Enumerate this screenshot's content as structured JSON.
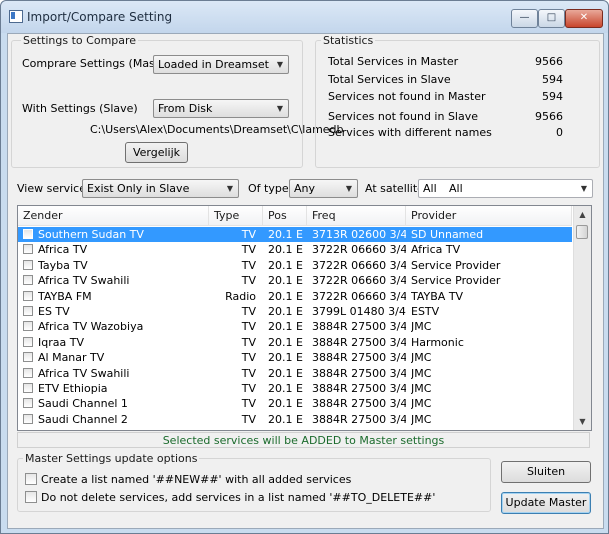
{
  "window": {
    "title": "Import/Compare Setting",
    "minimize_glyph": "—",
    "maximize_glyph": "□",
    "close_glyph": "✕"
  },
  "settings_group": {
    "title": "Settings to Compare",
    "master_label": "Comprare Settings (Master)",
    "master_value": "Loaded in Dreamset",
    "slave_label": "With Settings (Slave)",
    "slave_value": "From Disk",
    "path": "C:\\Users\\Alex\\Documents\\Dreamset\\C\\lamedb",
    "compare_button": "Vergelijk"
  },
  "statistics": {
    "title": "Statistics",
    "rows": [
      {
        "label": "Total Services in Master",
        "value": "9566"
      },
      {
        "label": "Total Services in Slave",
        "value": "594"
      },
      {
        "label": "Services not found in Master",
        "value": "594"
      },
      {
        "label": "Services not found in Slave",
        "value": "9566"
      },
      {
        "label": "Services with different names",
        "value": "0"
      }
    ]
  },
  "filters": {
    "view_label": "View services",
    "view_value": "Exist Only in Slave",
    "type_label": "Of type",
    "type_value": "Any",
    "satellite_label": "At satellite",
    "satellite_value_a": "All",
    "satellite_value_b": "All"
  },
  "table": {
    "columns": [
      "Zender",
      "Type",
      "Pos",
      "Freq",
      "Provider"
    ],
    "rows": [
      {
        "name": "Southern Sudan TV",
        "type": "TV",
        "pos": "20.1 E",
        "freq": "3713R 02600 3/4",
        "provider": "SD Unnamed",
        "selected": true
      },
      {
        "name": "Africa TV",
        "type": "TV",
        "pos": "20.1 E",
        "freq": "3722R 06660 3/4",
        "provider": "Africa TV"
      },
      {
        "name": "Tayba TV",
        "type": "TV",
        "pos": "20.1 E",
        "freq": "3722R 06660 3/4",
        "provider": "Service Provider"
      },
      {
        "name": "Africa TV Swahili",
        "type": "TV",
        "pos": "20.1 E",
        "freq": "3722R 06660 3/4",
        "provider": "Service Provider"
      },
      {
        "name": "TAYBA FM",
        "type": "Radio",
        "pos": "20.1 E",
        "freq": "3722R 06660 3/4",
        "provider": "TAYBA TV"
      },
      {
        "name": "ES TV",
        "type": "TV",
        "pos": "20.1 E",
        "freq": "3799L 01480 3/4",
        "provider": "ESTV"
      },
      {
        "name": "Africa TV Wazobiya",
        "type": "TV",
        "pos": "20.1 E",
        "freq": "3884R 27500 3/4",
        "provider": "JMC"
      },
      {
        "name": "Iqraa TV",
        "type": "TV",
        "pos": "20.1 E",
        "freq": "3884R 27500 3/4",
        "provider": "Harmonic"
      },
      {
        "name": "Al Manar TV",
        "type": "TV",
        "pos": "20.1 E",
        "freq": "3884R 27500 3/4",
        "provider": "JMC"
      },
      {
        "name": "Africa TV Swahili",
        "type": "TV",
        "pos": "20.1 E",
        "freq": "3884R 27500 3/4",
        "provider": "JMC"
      },
      {
        "name": "ETV Ethiopia",
        "type": "TV",
        "pos": "20.1 E",
        "freq": "3884R 27500 3/4",
        "provider": "JMC"
      },
      {
        "name": "Saudi Channel 1",
        "type": "TV",
        "pos": "20.1 E",
        "freq": "3884R 27500 3/4",
        "provider": "JMC"
      },
      {
        "name": "Saudi Channel 2",
        "type": "TV",
        "pos": "20.1 E",
        "freq": "3884R 27500 3/4",
        "provider": "JMC"
      }
    ]
  },
  "status_message": "Selected services will be ADDED to Master settings",
  "update_options": {
    "title": "Master Settings update options",
    "option1": "Create a list named  '##NEW##' with all added services",
    "option2": "Do not delete services, add services in a list named '##TO_DELETE##'"
  },
  "buttons": {
    "close": "Sluiten",
    "update": "Update Master"
  },
  "colors": {
    "selection": "#3399ff",
    "status_text": "#1b6b2d"
  }
}
